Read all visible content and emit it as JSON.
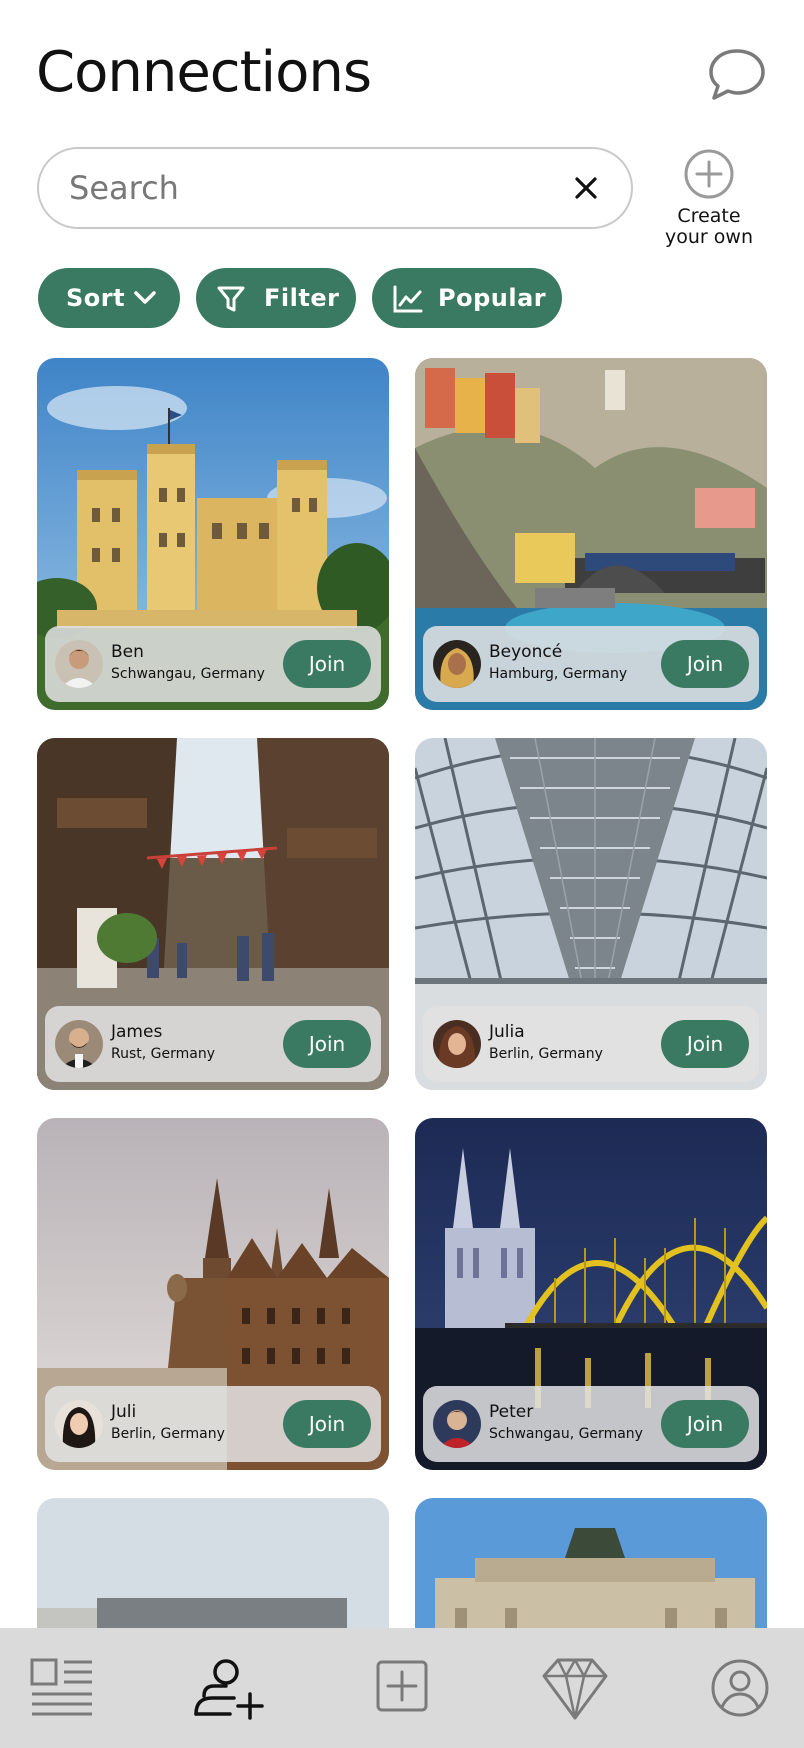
{
  "header": {
    "title": "Connections"
  },
  "search": {
    "placeholder": "Search",
    "value": ""
  },
  "create": {
    "line1": "Create",
    "line2": "your own"
  },
  "chips": [
    {
      "label": "Sort",
      "icon": "chevron-down-icon"
    },
    {
      "label": "Filter",
      "icon": "filter-icon"
    },
    {
      "label": "Popular",
      "icon": "trending-chart-icon"
    }
  ],
  "join_label": "Join",
  "cards": [
    {
      "name": "Ben",
      "location": "Schwangau, Germany",
      "scene": "castle-photo"
    },
    {
      "name": "Beyoncé",
      "location": "Hamburg, Germany",
      "scene": "miniature-town-photo"
    },
    {
      "name": "James",
      "location": "Rust, Germany",
      "scene": "village-street-photo"
    },
    {
      "name": "Julia",
      "location": "Berlin, Germany",
      "scene": "glass-dome-photo"
    },
    {
      "name": "Juli",
      "location": "Berlin, Germany",
      "scene": "town-hall-photo"
    },
    {
      "name": "Peter",
      "location": "Schwangau, Germany",
      "scene": "cathedral-bridge-photo"
    }
  ],
  "tabs": [
    {
      "icon": "feed-icon"
    },
    {
      "icon": "add-connection-icon"
    },
    {
      "icon": "create-post-icon"
    },
    {
      "icon": "diamond-icon"
    },
    {
      "icon": "profile-icon"
    }
  ],
  "colors": {
    "accent": "#3a7a62",
    "tabbar": "#dadada",
    "overlay": "#e2e2e2"
  }
}
